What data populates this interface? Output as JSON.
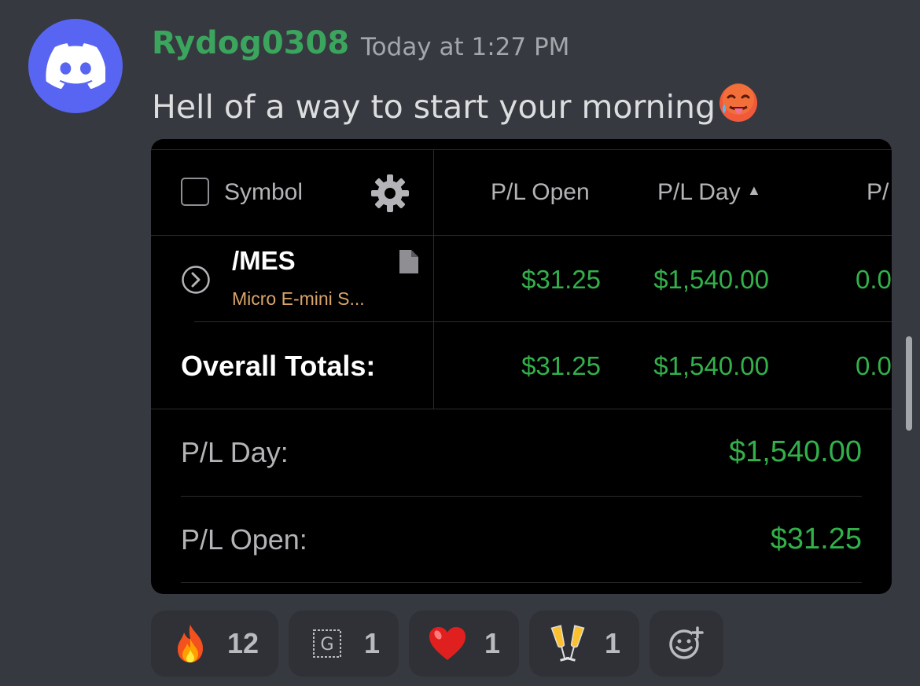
{
  "message": {
    "username": "Rydog0308",
    "timestamp": "Today at 1:27 PM",
    "text": "Hell of a way to start your morning",
    "emoji_icon": "hot-face-emoji"
  },
  "colors": {
    "background": "#36393f",
    "username": "#3ba55d",
    "avatar": "#5865f2",
    "gain_green": "#32b04a",
    "description_orange": "#d9a46a"
  },
  "embed": {
    "header": {
      "symbol": "Symbol",
      "pl_open": "P/L Open",
      "pl_day": "P/L Day",
      "sort_indicator": "▲",
      "pl_truncated": "P/"
    },
    "row": {
      "symbol": "/MES",
      "description": "Micro E-mini S...",
      "pl_open": "$31.25",
      "pl_day": "$1,540.00",
      "pl_pct": "0.0"
    },
    "totals": {
      "label": "Overall Totals:",
      "pl_open": "$31.25",
      "pl_day": "$1,540.00",
      "pl_pct": "0.0"
    },
    "summary": [
      {
        "label": "P/L Day:",
        "value": "$1,540.00"
      },
      {
        "label": "P/L Open:",
        "value": "$31.25"
      }
    ]
  },
  "reactions": [
    {
      "icon": "fire-emoji",
      "count": "12"
    },
    {
      "icon": "g-emote-icon",
      "count": "1"
    },
    {
      "icon": "red-heart-emoji",
      "count": "1"
    },
    {
      "icon": "clinking-glasses-emoji",
      "count": "1"
    }
  ]
}
